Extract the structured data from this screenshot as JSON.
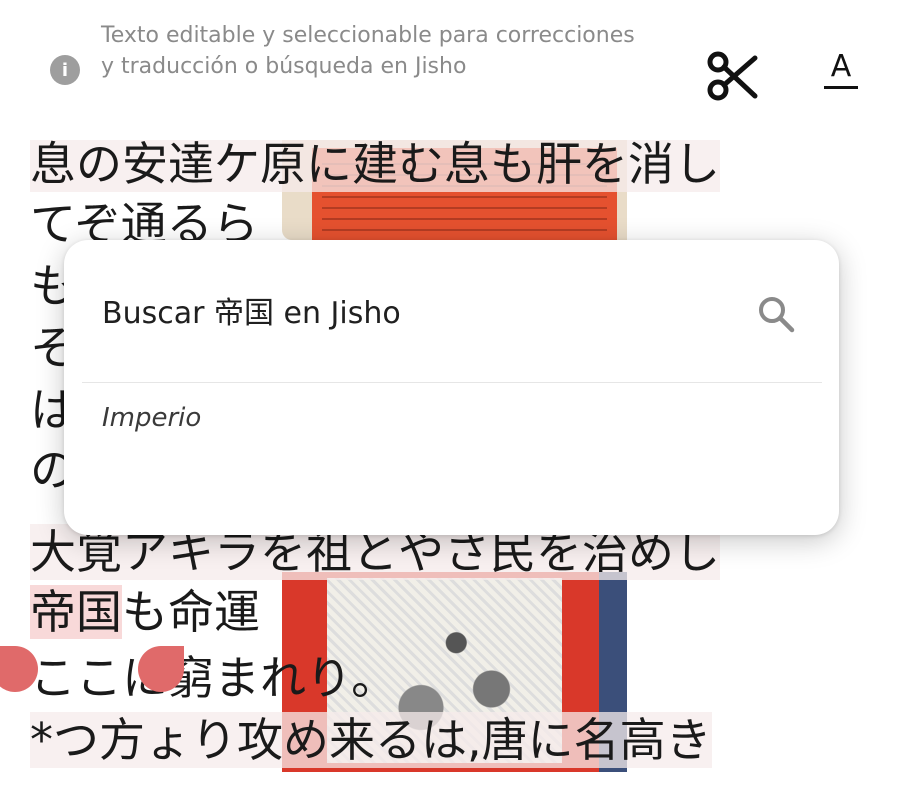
{
  "toolbar": {
    "info_text": "Texto editable y seleccionable para correcciones y traducción o búsqueda en Jisho",
    "info_icon": "info-icon",
    "scissors_icon": "scissors-icon",
    "font_button_letter": "A"
  },
  "ocr_lines": [
    "息の安達ケ原に建む息も肝を消し",
    "てぞ通るら",
    "も",
    "そ",
    "は",
    "の",
    "大覚アキラを祖とやさ民を治めし",
    "帝国も命運",
    "ここに窮まれり。",
    "*つ方ょり攻め来るは,唐に名高き"
  ],
  "selection": {
    "selected_text": "帝国",
    "rest_of_line": "も命運"
  },
  "popup": {
    "search_label": "Buscar 帝国 en Jisho",
    "translation": "Imperio"
  },
  "colors": {
    "selection_handle": "#e06a6a",
    "selection_highlight": "#f0aaaa",
    "info_text": "#8a8a8a"
  }
}
